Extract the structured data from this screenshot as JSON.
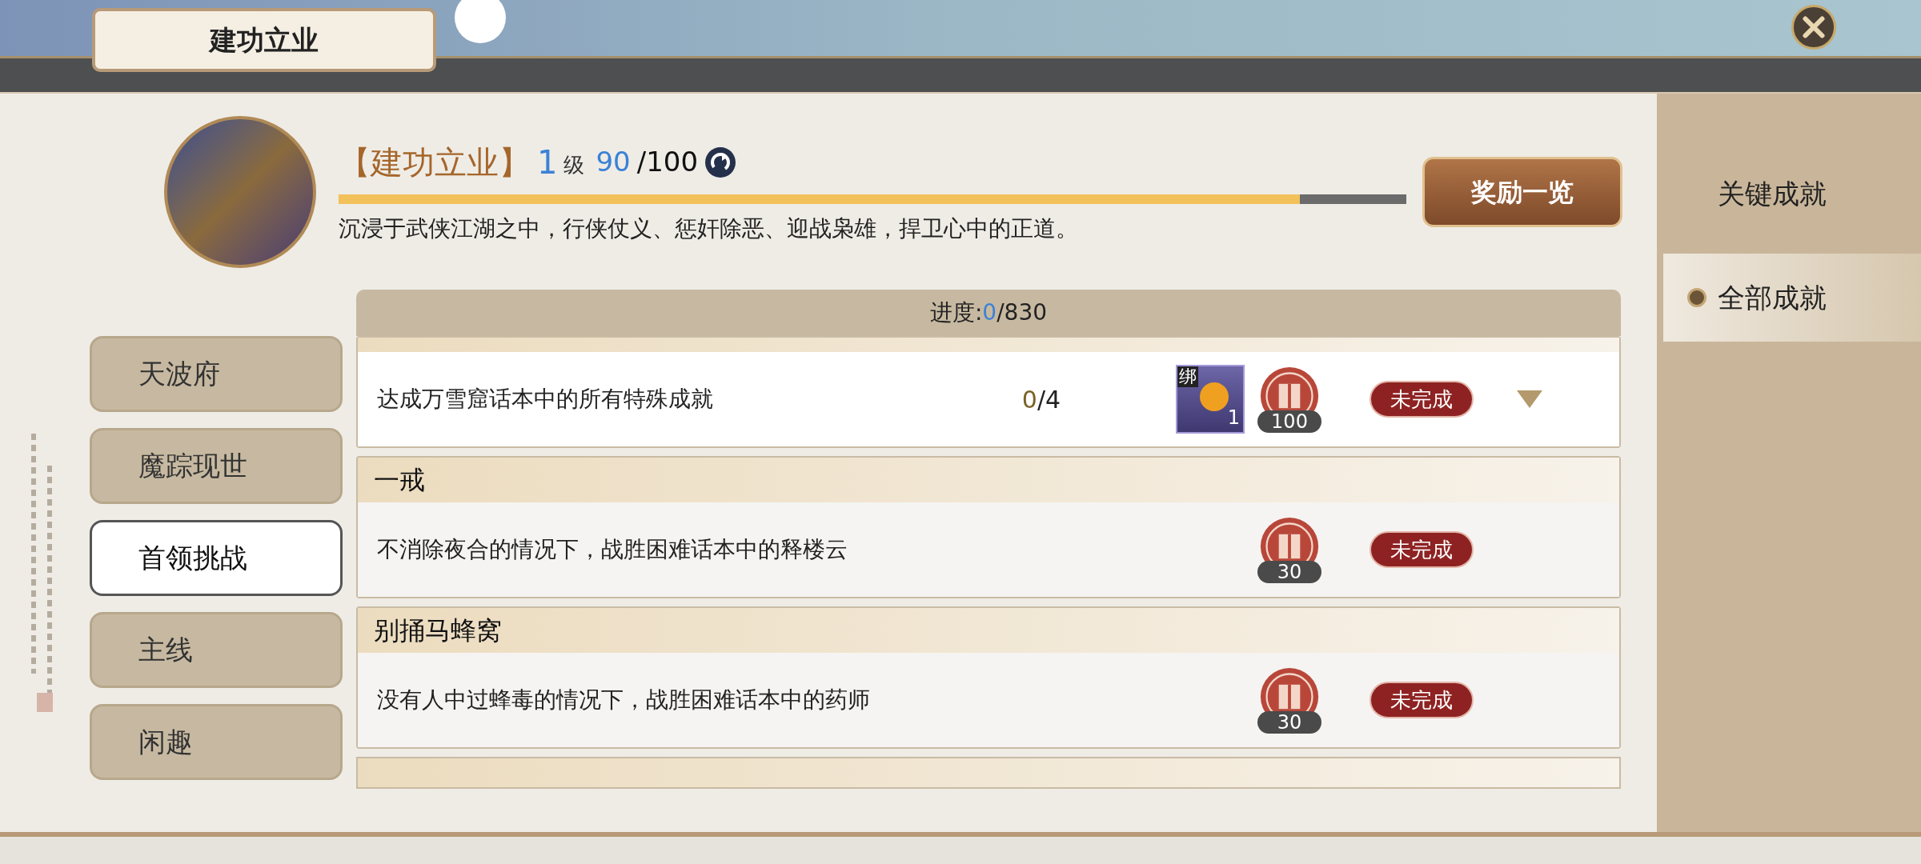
{
  "header": {
    "title": "建功立业"
  },
  "achievement": {
    "name": "【建功立业】",
    "level": "1",
    "level_unit": "级",
    "points": "90",
    "points_total": "/100",
    "progress": {
      "level": 0.9
    },
    "description": "沉浸于武侠江湖之中，行侠仗义、惩奸除恶、迎战枭雄，捍卫心中的正道。"
  },
  "reward_button": "奖励一览",
  "categories": [
    {
      "label": "天波府",
      "selected": false
    },
    {
      "label": "魔踪现世",
      "selected": false
    },
    {
      "label": "首领挑战",
      "selected": true
    },
    {
      "label": "主线",
      "selected": false
    },
    {
      "label": "闲趣",
      "selected": false
    }
  ],
  "progress_header": {
    "label": "进度:",
    "done": "0",
    "total": "/830"
  },
  "rows": [
    {
      "description": "达成万雪窟话本中的所有特殊成就",
      "count_done": "0",
      "count_total": "/4",
      "item": {
        "tag": "绑",
        "count": "1"
      },
      "coin": "100",
      "status": "未完成",
      "expandable": true
    },
    {
      "title": "一戒",
      "description": "不消除夜合的情况下，战胜困难话本中的释楼云",
      "coin": "30",
      "status": "未完成",
      "expandable": false
    },
    {
      "title": "别捅马蜂窝",
      "description": "没有人中过蜂毒的情况下，战胜困难话本中的药师",
      "coin": "30",
      "status": "未完成",
      "expandable": false
    }
  ],
  "sidebar": [
    {
      "label": "关键成就",
      "selected": false
    },
    {
      "label": "全部成就",
      "selected": true
    }
  ]
}
